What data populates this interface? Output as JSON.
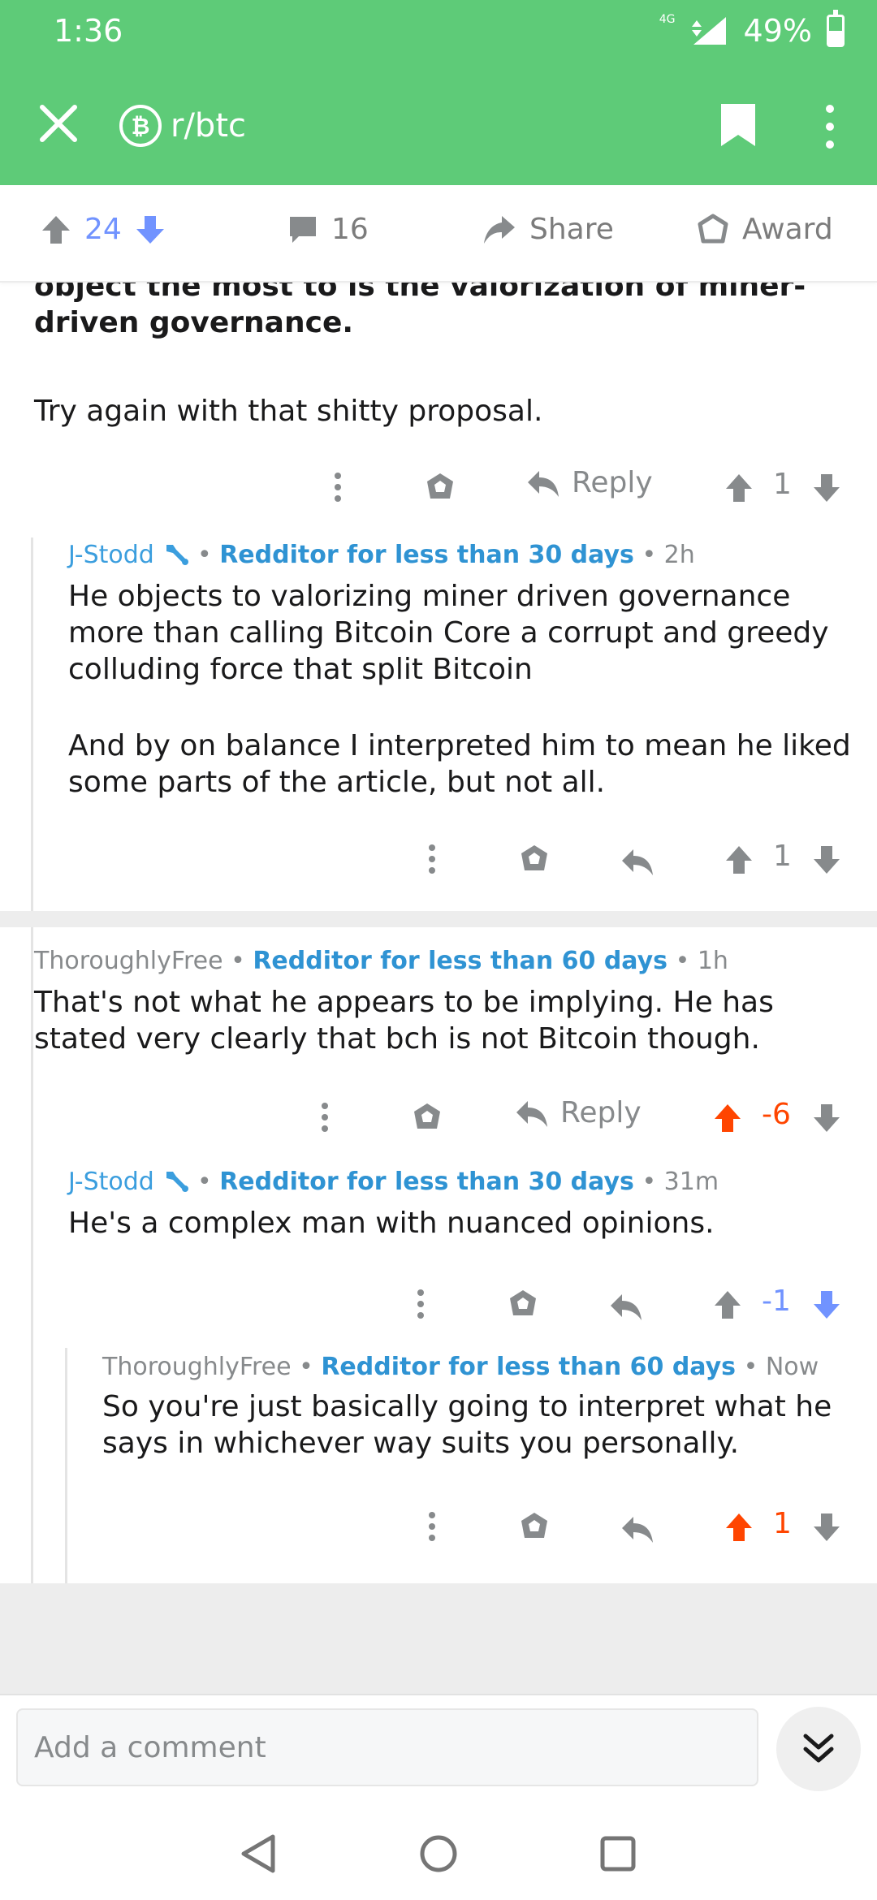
{
  "status": {
    "time": "1:36",
    "network": "4G",
    "battery": "49%",
    "battery_level": 0.49
  },
  "header": {
    "subreddit": "r/btc"
  },
  "post_actions": {
    "score": "24",
    "comments": "16",
    "share_label": "Share",
    "award_label": "Award"
  },
  "comments": [
    {
      "body_bold": "object the most to is the valorization of miner-driven governance.",
      "body": "Try again with that shitty proposal.",
      "reply_label": "Reply",
      "score": "1"
    },
    {
      "author": "J-Stodd",
      "flair": "Redditor for less than 30 days",
      "age": "2h",
      "body_p1": "He objects to valorizing miner driven governance more than calling Bitcoin Core a corrupt and greedy colluding force that split Bitcoin",
      "body_p2": "And by on balance I interpreted him to mean he liked some parts of the article, but not all.",
      "score": "1"
    },
    {
      "author": "ThoroughlyFree",
      "flair": "Redditor for less than 60 days",
      "age": "1h",
      "body": "That's not what he appears to be implying.  He has stated very clearly that bch is not Bitcoin though.",
      "reply_label": "Reply",
      "score": "-6"
    },
    {
      "author": "J-Stodd",
      "flair": "Redditor for less than 30 days",
      "age": "31m",
      "body": "He's a complex man with nuanced opinions.",
      "score": "-1"
    },
    {
      "author": "ThoroughlyFree",
      "flair": "Redditor for less than 60 days",
      "age": "Now",
      "body": "So you're just basically going to interpret what he says in whichever way suits you personally.",
      "score": "1"
    }
  ],
  "composer": {
    "placeholder": "Add a comment"
  },
  "colors": {
    "header_green": "#5ecb78",
    "upvote": "#ff4500",
    "downvote": "#7193ff",
    "flair_blue": "#2f93d3"
  }
}
